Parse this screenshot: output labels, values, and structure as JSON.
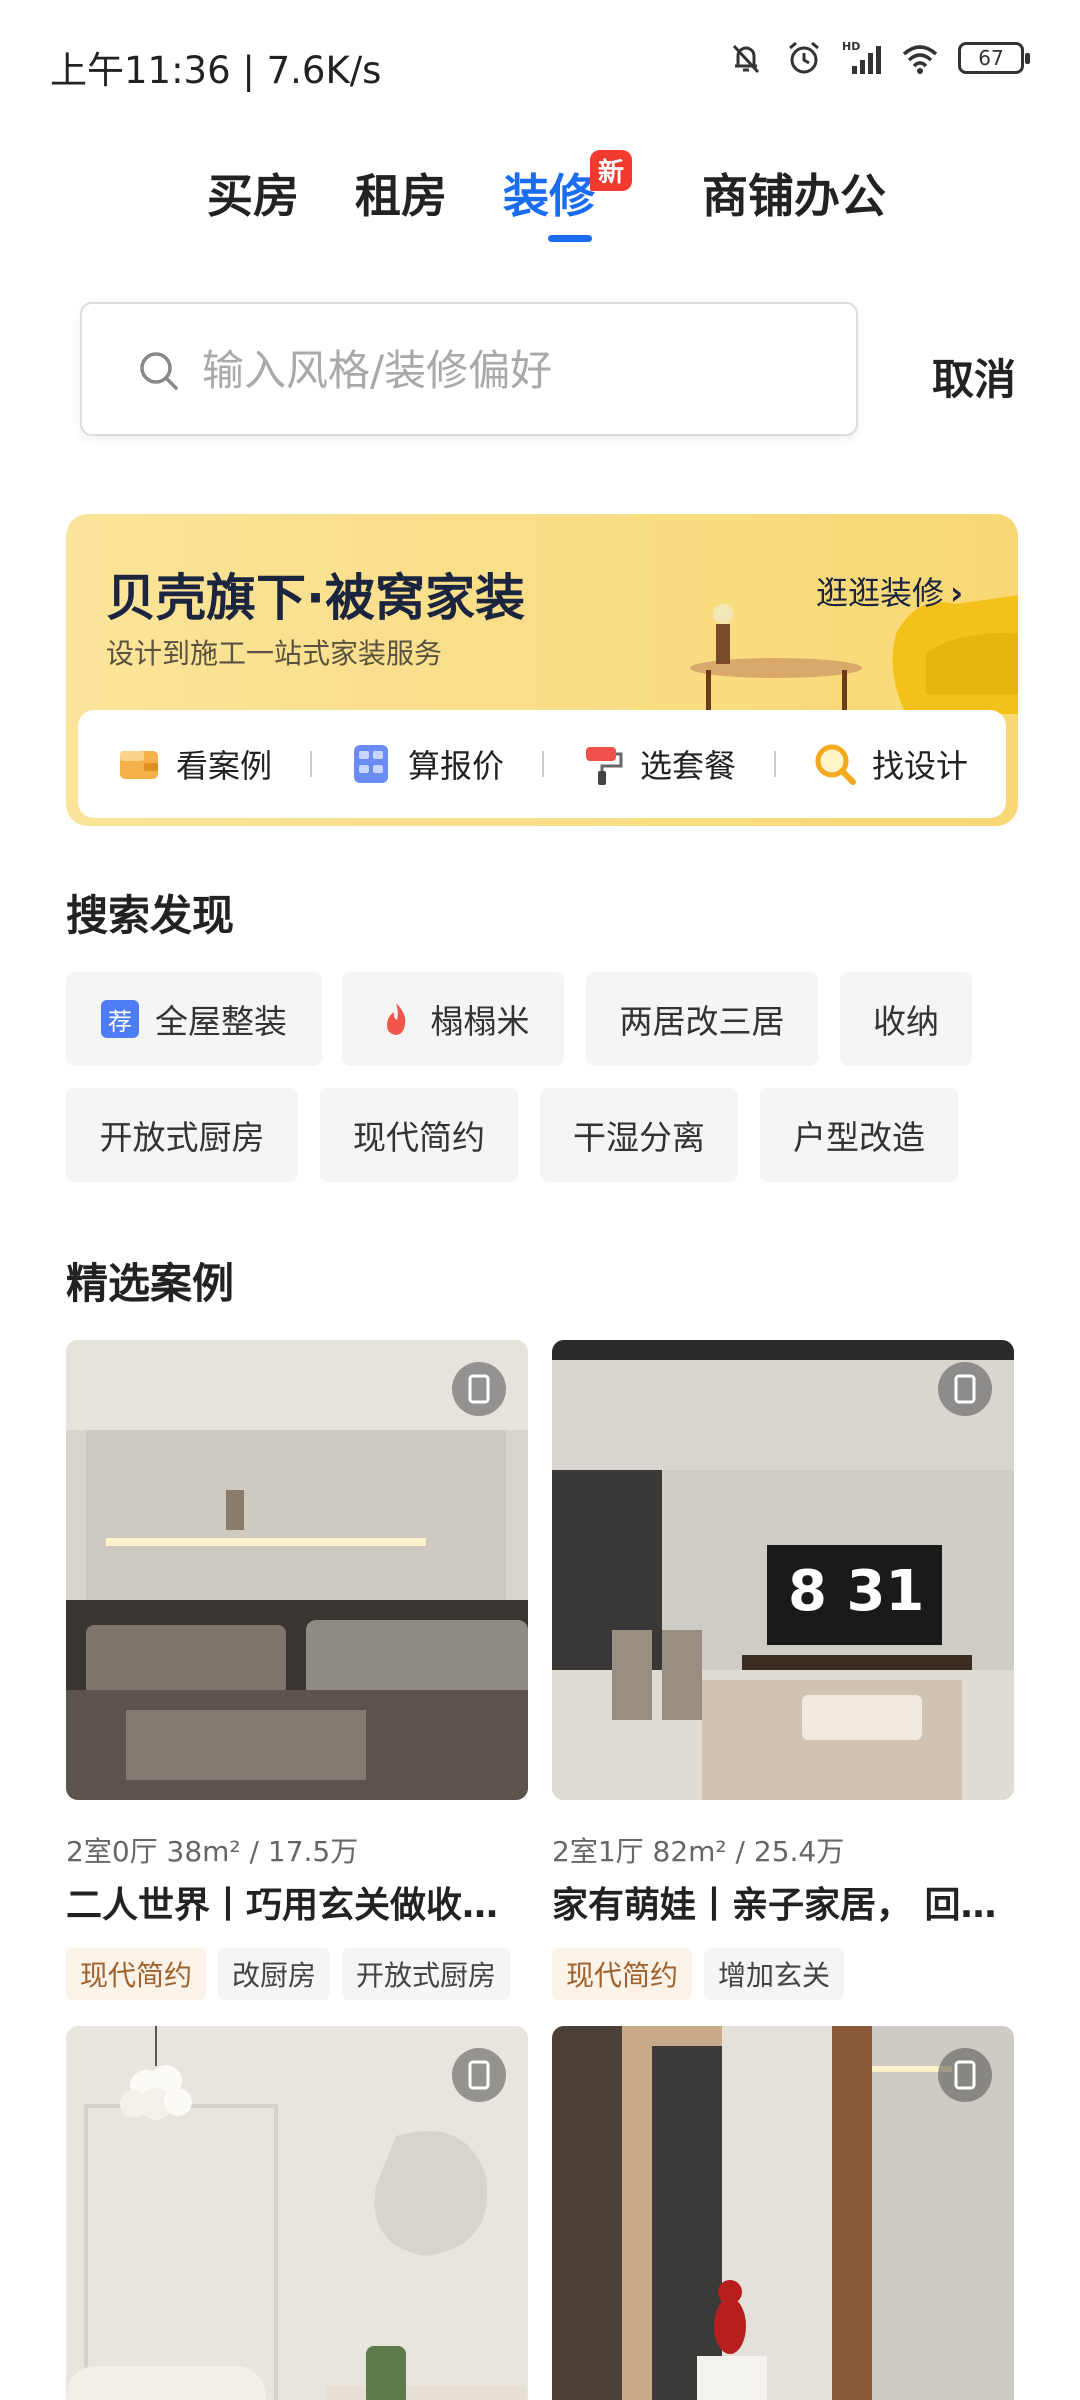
{
  "status_bar": {
    "time_speed": "上午11:36 | 7.6K/s",
    "battery": "67",
    "icons": [
      "bell-off-icon",
      "alarm-icon",
      "signal-icon",
      "wifi-icon",
      "battery-icon"
    ]
  },
  "tabs": [
    {
      "label": "买房",
      "active": false
    },
    {
      "label": "租房",
      "active": false
    },
    {
      "label": "装修",
      "active": true
    },
    {
      "label": "商铺办公",
      "active": false
    }
  ],
  "tab_badge": "新",
  "search": {
    "placeholder": "输入风格/装修偏好",
    "value": "",
    "cancel": "取消"
  },
  "banner": {
    "title": "贝壳旗下·被窝家装",
    "subtitle": "设计到施工一站式家装服务",
    "link": "逛逛装修",
    "actions": [
      {
        "label": "看案例",
        "icon": "wallet-icon"
      },
      {
        "label": "算报价",
        "icon": "calculator-icon"
      },
      {
        "label": "选套餐",
        "icon": "paint-roller-icon"
      },
      {
        "label": "找设计",
        "icon": "magnifier-icon"
      }
    ]
  },
  "discover": {
    "title": "搜索发现",
    "chips": [
      {
        "label": "全屋整装",
        "icon": "recommend-icon",
        "icon_text": "荐"
      },
      {
        "label": "榻榻米",
        "icon": "fire-icon"
      },
      {
        "label": "两居改三居"
      },
      {
        "label": "收纳"
      },
      {
        "label": "开放式厨房"
      },
      {
        "label": "现代简约"
      },
      {
        "label": "干湿分离"
      },
      {
        "label": "户型改造"
      }
    ]
  },
  "cases": {
    "title": "精选案例",
    "items": [
      {
        "meta": "2室0厅 38m² / 17.5万",
        "title": "二人世界丨巧用玄关做收纳空间",
        "tags": [
          "现代简约",
          "改厨房",
          "开放式厨房"
        ]
      },
      {
        "meta": "2室1厅 82m² / 25.4万",
        "title": "家有萌娃丨亲子家居， 回归温馨",
        "tags": [
          "现代简约",
          "增加玄关"
        ],
        "tv_text": "8 31"
      },
      {
        "meta": "",
        "title": "",
        "tags": []
      },
      {
        "meta": "",
        "title": "",
        "tags": []
      }
    ]
  },
  "colors": {
    "accent": "#1a6cf0",
    "badge": "#f23a2f",
    "banner": "#f8d874",
    "style_tag_text": "#a0622d"
  }
}
